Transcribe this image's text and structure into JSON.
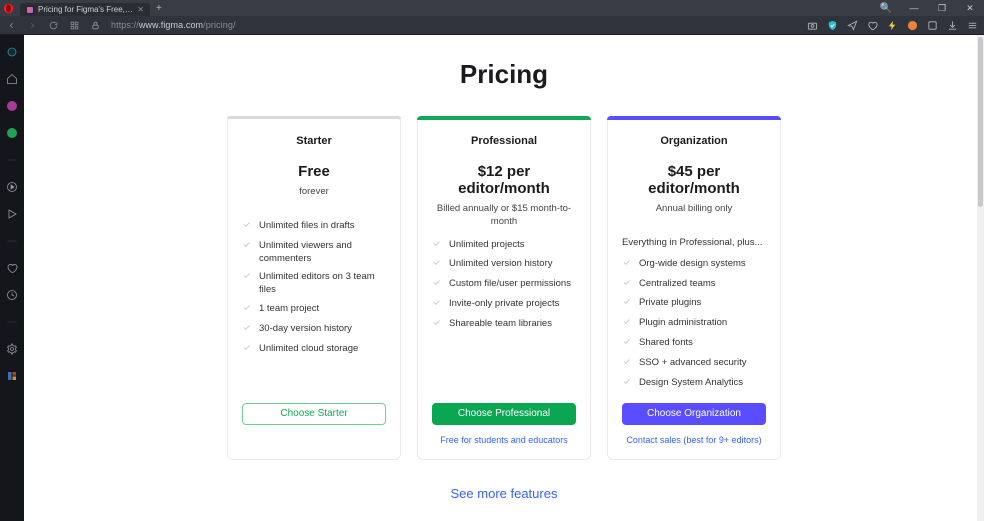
{
  "browser": {
    "tab_title": "Pricing for Figma's Free, Pr",
    "url_scheme": "https://",
    "url_host": "www.figma.com",
    "url_path": "/pricing/"
  },
  "wincontrols": {
    "search": "⌕",
    "min": "—",
    "max": "❐",
    "close": "✕"
  },
  "page": {
    "title": "Pricing",
    "see_more": "See more features"
  },
  "plans": [
    {
      "name": "Starter",
      "price": "Free",
      "subline": "forever",
      "features_intro": "",
      "features": [
        "Unlimited files in drafts",
        "Unlimited viewers and commenters",
        "Unlimited editors on 3 team files",
        "1 team project",
        "30-day version history",
        "Unlimited cloud storage"
      ],
      "cta": "Choose Starter",
      "below": ""
    },
    {
      "name": "Professional",
      "price": "$12 per editor/month",
      "subline": "Billed annually or $15 month-to-month",
      "features_intro": "",
      "features": [
        "Unlimited projects",
        "Unlimited version history",
        "Custom file/user permissions",
        "Invite-only private projects",
        "Shareable team libraries"
      ],
      "cta": "Choose Professional",
      "below": "Free for students and educators"
    },
    {
      "name": "Organization",
      "price": "$45 per editor/month",
      "subline": "Annual billing only",
      "features_intro": "Everything in Professional, plus...",
      "features": [
        "Org-wide design systems",
        "Centralized teams",
        "Private plugins",
        "Plugin administration",
        "Shared fonts",
        "SSO + advanced security",
        "Design System Analytics"
      ],
      "cta": "Choose Organization",
      "below": "Contact sales (best for 9+ editors)"
    }
  ]
}
